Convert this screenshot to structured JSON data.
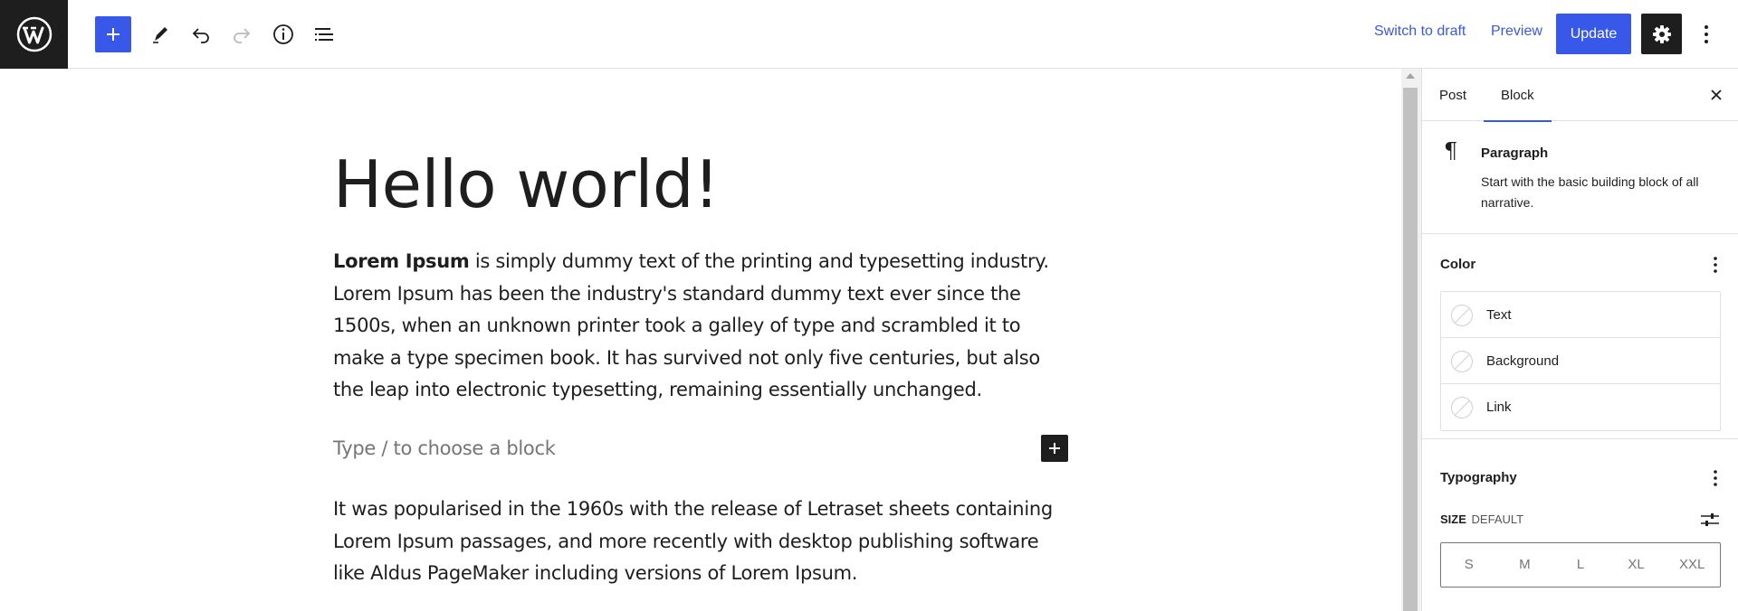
{
  "topbar": {
    "logo_icon": "wordpress-logo-icon",
    "switch_to_draft_label": "Switch to draft",
    "preview_label": "Preview",
    "update_label": "Update",
    "accent_color": "#3858e9"
  },
  "editor": {
    "title": "Hello world!",
    "para1_bold": "Lorem Ipsum",
    "para1_rest": " is simply dummy text of the printing and typesetting industry. Lorem Ipsum has been the industry's standard dummy text ever since the 1500s, when an unknown printer took a galley of type and scrambled it to make a type specimen book. It has survived not only five centuries, but also the leap into electronic typesetting, remaining essentially unchanged.",
    "block_placeholder": "Type / to choose a block",
    "para2": "It was popularised in the 1960s with the release of Letraset sheets containing Lorem Ipsum passages, and more recently with desktop publishing software like Aldus PageMaker including versions of Lorem Ipsum."
  },
  "sidebar": {
    "tabs": [
      {
        "label": "Post"
      },
      {
        "label": "Block"
      }
    ],
    "active_tab": "Block",
    "block_card": {
      "title": "Paragraph",
      "description": "Start with the basic building block of all narrative."
    },
    "color": {
      "title": "Color",
      "items": [
        {
          "label": "Text"
        },
        {
          "label": "Background"
        },
        {
          "label": "Link"
        }
      ]
    },
    "typography": {
      "title": "Typography",
      "size_label": "SIZE",
      "size_value": "DEFAULT",
      "sizes": [
        "S",
        "M",
        "L",
        "XL",
        "XXL"
      ]
    }
  }
}
